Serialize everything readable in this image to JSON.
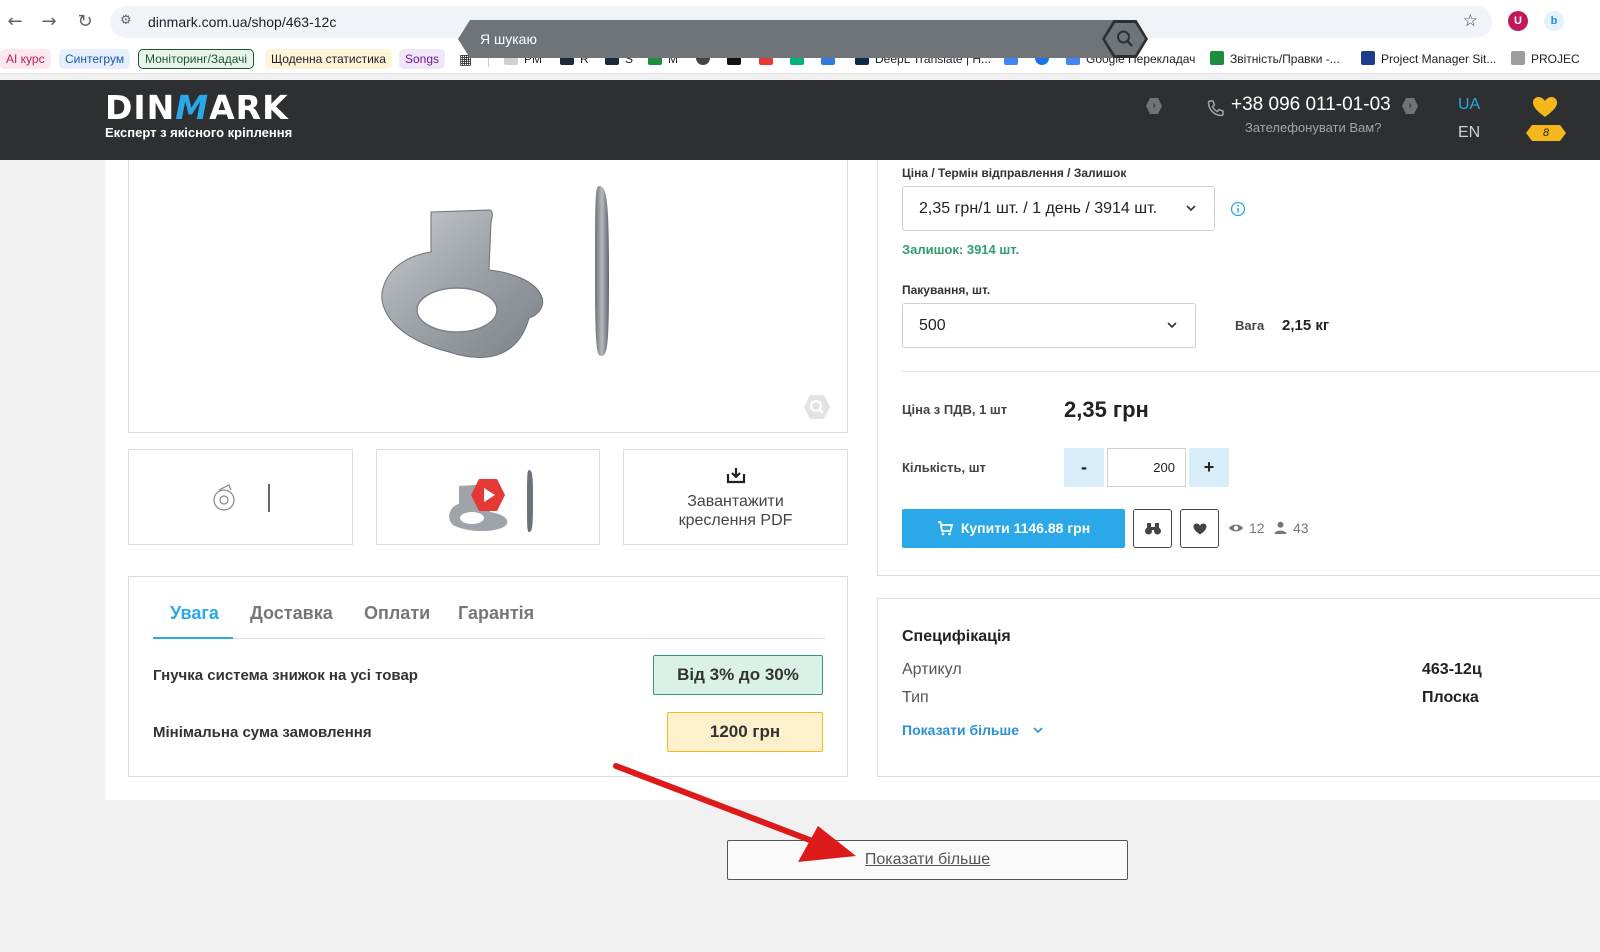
{
  "browser": {
    "url": "dinmark.com.ua/shop/463-12c",
    "bookmarks": [
      {
        "label": "AI курс",
        "color": "#c2185b",
        "bg": "#fde7ef"
      },
      {
        "label": "Синтегрум",
        "color": "#1a56b0",
        "bg": "#e7effc"
      },
      {
        "label": "Моніторинг/Задачі",
        "color": "#1e5631",
        "bg": "#e6f4ea"
      },
      {
        "label": "Щоденна статистика",
        "color": "#202124",
        "bg": "#fef4d8"
      },
      {
        "label": "Songs",
        "color": "#6a1b9a",
        "bg": "#f1e6f8"
      },
      {
        "label": "PM"
      },
      {
        "label": "R"
      },
      {
        "label": "S"
      },
      {
        "label": "M"
      },
      {
        "label": "DeepL Translate | H..."
      },
      {
        "label": "Google Перекладач"
      },
      {
        "label": "Звітність/Правки -..."
      },
      {
        "label": "Project Manager Sit..."
      },
      {
        "label": "PROJEC"
      }
    ]
  },
  "header": {
    "logo_left": "DIN",
    "logo_m": "M",
    "logo_right": "ARK",
    "tagline": "Експерт з якісного кріплення",
    "search_placeholder": "Я шукаю",
    "phone": "+38 096 011-01-03",
    "callback": "Зателефонувати Вам?",
    "lang_active": "UA",
    "lang_other": "EN",
    "cart_count": "8",
    "accent_color": "#2aa8e8",
    "gold_color": "#f5b81c"
  },
  "gallery": {
    "pdf_label_1": "Завантажити",
    "pdf_label_2": "креслення PDF"
  },
  "tabs": {
    "items": [
      "Увага",
      "Доставка",
      "Оплати",
      "Гарантія"
    ],
    "notices": [
      {
        "text": "Гнучка система знижок на усі товар",
        "badge": "Від 3% до 30%",
        "badge_bg": "#d9f1e6",
        "badge_border": "#2f9e6e"
      },
      {
        "text": "Мінімальна сума замовлення",
        "badge": "1200 грн",
        "badge_bg": "#fdf0cc",
        "badge_border": "#f5b81c"
      }
    ]
  },
  "buy": {
    "price_term_label": "Ціна / Термін відправлення / Залишок",
    "price_term_value": "2,35 грн/1 шт. / 1 день / 3914 шт.",
    "stock_text": "Залишок: 3914 шт.",
    "pack_label": "Пакування, шт.",
    "pack_value": "500",
    "weight_label": "Вага",
    "weight_value": "2,15 кг",
    "price_label": "Ціна з ПДВ, 1 шт",
    "price_value": "2,35 грн",
    "qty_label": "Кількість, шт",
    "qty_minus": "-",
    "qty_plus": "+",
    "qty_value": "200",
    "buy_label": "Купити 1146.88 грн",
    "views": "12",
    "buyers": "43"
  },
  "spec": {
    "title": "Специфікація",
    "rows": [
      {
        "key": "Артикул",
        "value": "463-12ц"
      },
      {
        "key": "Тип",
        "value": "Плоска"
      }
    ],
    "more_label": "Показати більше"
  },
  "show_more_label": "Показати більше"
}
